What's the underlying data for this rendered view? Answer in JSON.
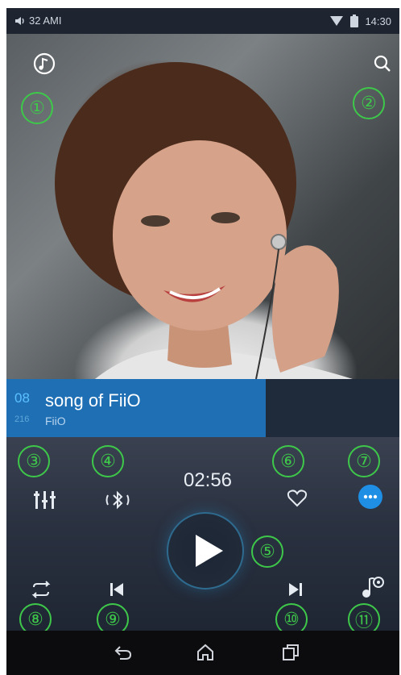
{
  "status_bar": {
    "left_text": "32 AMI",
    "time": "14:30",
    "icons": [
      "volume-icon",
      "wifi-icon",
      "battery-icon"
    ]
  },
  "top_bar": {
    "left_icon": "music-note-icon",
    "right_icon": "search-icon"
  },
  "callouts": {
    "c1": "①",
    "c2": "②",
    "c3": "③",
    "c4": "④",
    "c5": "⑤",
    "c6": "⑥",
    "c7": "⑦",
    "c8": "⑧",
    "c9": "⑨",
    "c10": "⑩",
    "c11": "⑪"
  },
  "now_playing": {
    "track_number": "08",
    "track_total": "216",
    "title": "song of FiiO",
    "artist": "FiiO"
  },
  "controls": {
    "time": "02:56",
    "icons": [
      "equalizer-icon",
      "bluetooth-icon",
      "heart-icon",
      "more-icon",
      "repeat-icon",
      "previous-icon",
      "play-icon",
      "next-icon",
      "playlist-icon"
    ]
  },
  "nav_bar": {
    "icons": [
      "back-icon",
      "home-icon",
      "recent-apps-icon"
    ]
  },
  "colors": {
    "callout_green": "#3ec84a",
    "accent_blue": "#1f6fb5",
    "more_button_blue": "#1f8fe6",
    "track_number_blue": "#5bc0ff"
  }
}
